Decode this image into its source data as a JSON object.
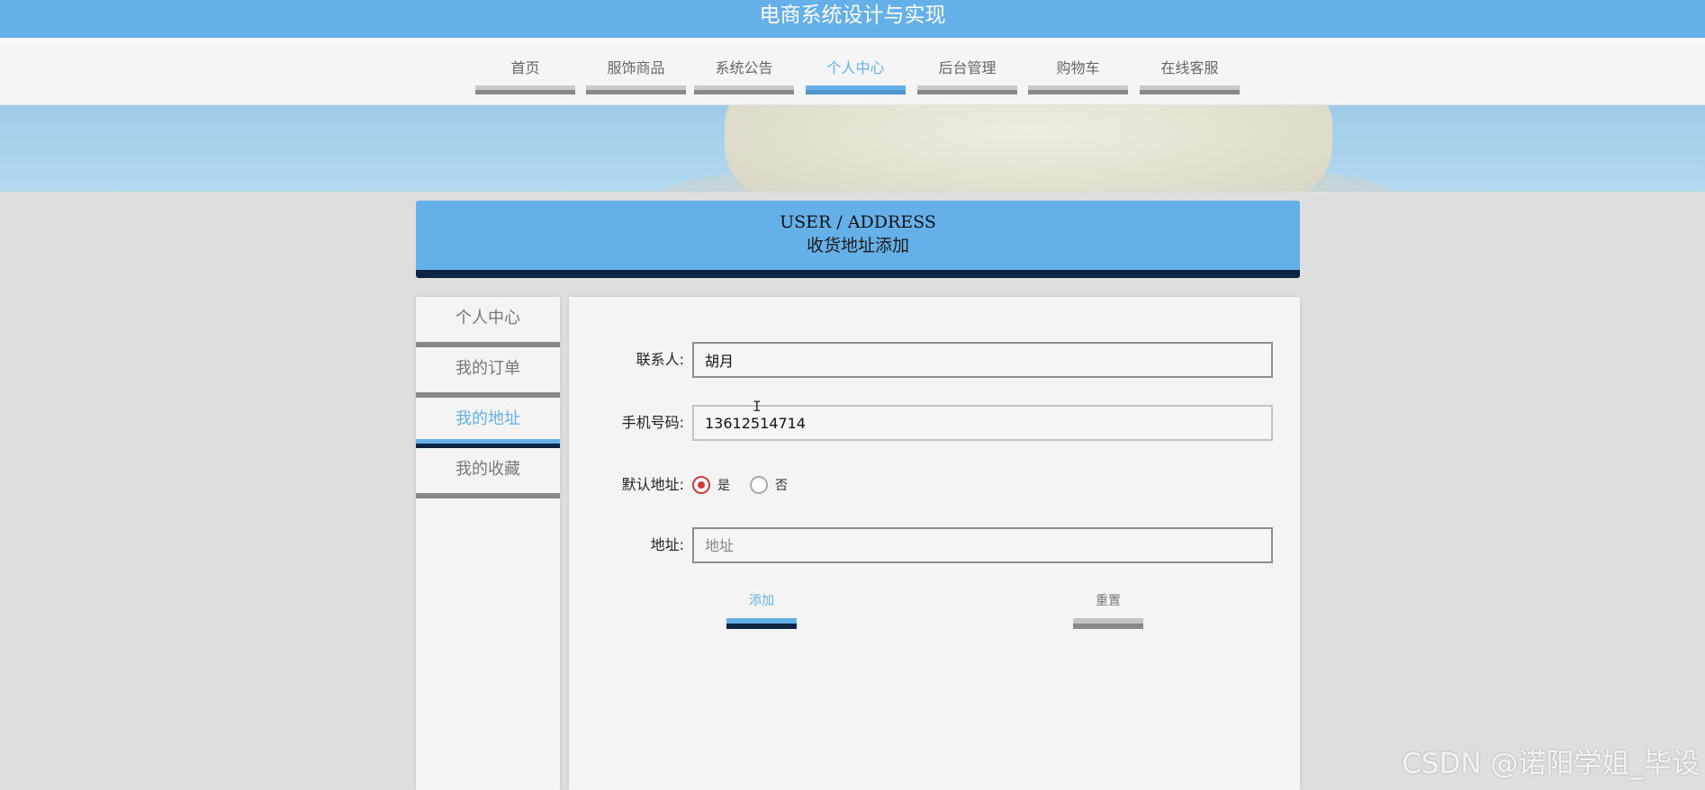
{
  "site": {
    "title": "电商系统设计与实现"
  },
  "nav": {
    "items": [
      {
        "label": "首页",
        "active": false
      },
      {
        "label": "服饰商品",
        "active": false
      },
      {
        "label": "系统公告",
        "active": false
      },
      {
        "label": "个人中心",
        "active": true
      },
      {
        "label": "后台管理",
        "active": false
      },
      {
        "label": "购物车",
        "active": false
      },
      {
        "label": "在线客服",
        "active": false
      }
    ]
  },
  "section_header": {
    "en": "USER / ADDRESS",
    "cn": "收货地址添加"
  },
  "sidebar": {
    "items": [
      {
        "label": "个人中心",
        "active": false
      },
      {
        "label": "我的订单",
        "active": false
      },
      {
        "label": "我的地址",
        "active": true
      },
      {
        "label": "我的收藏",
        "active": false
      }
    ]
  },
  "form": {
    "contact": {
      "label": "联系人:",
      "value": "胡月"
    },
    "phone": {
      "label": "手机号码:",
      "value": "13612514714"
    },
    "default_address": {
      "label": "默认地址:",
      "options": [
        "是",
        "否"
      ],
      "selected": "是"
    },
    "address": {
      "label": "地址:",
      "value": "",
      "placeholder": "地址"
    },
    "buttons": {
      "add": "添加",
      "reset": "重置"
    }
  },
  "watermark": "CSDN @诺阳学姐_毕设",
  "colors": {
    "accent": "#65b0e9",
    "dark_bar": "#0c2545",
    "radio_checked": "#d23b3b"
  }
}
